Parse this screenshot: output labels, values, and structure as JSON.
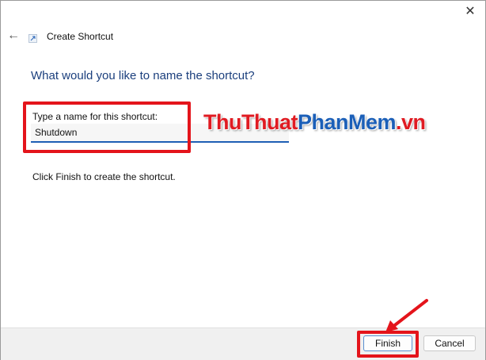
{
  "window": {
    "title": "Create Shortcut",
    "close_glyph": "✕",
    "back_glyph": "←"
  },
  "content": {
    "heading": "What would you like to name the shortcut?",
    "name_label": "Type a name for this shortcut:",
    "name_value": "Shutdown",
    "instruction": "Click Finish to create the shortcut."
  },
  "footer": {
    "finish_label": "Finish",
    "cancel_label": "Cancel"
  },
  "watermark": {
    "part1": "ThuThuat",
    "part2": "PhanMem",
    "part3": ".vn"
  },
  "colors": {
    "heading": "#1b3f7d",
    "highlight": "#e4141b",
    "input_underline": "#1f5fb5"
  },
  "icons": [
    "close-icon",
    "back-arrow-icon",
    "shortcut-icon",
    "annotation-arrow"
  ]
}
